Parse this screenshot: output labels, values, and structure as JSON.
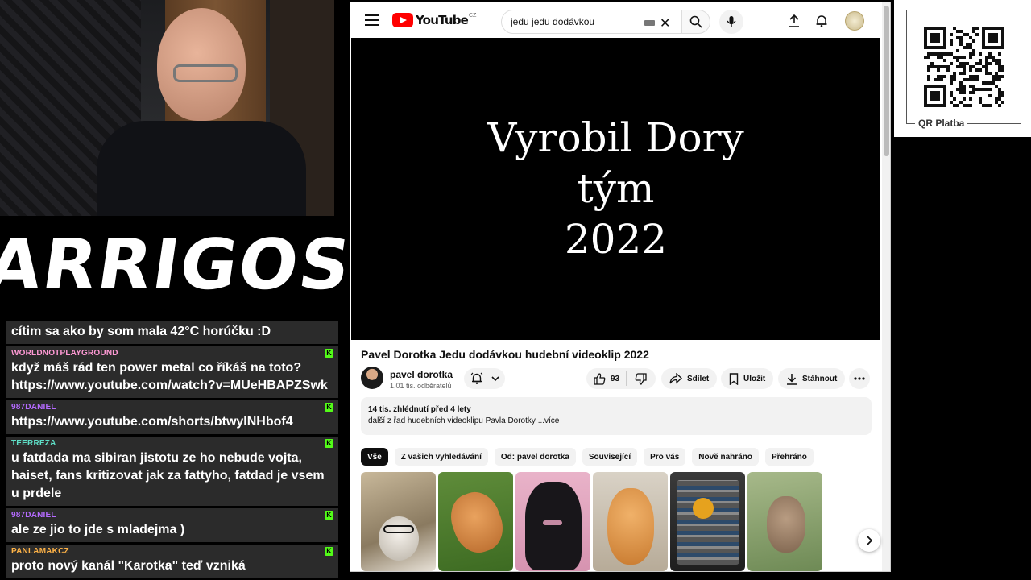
{
  "stream": {
    "logo_text": "ARRIGOS"
  },
  "chat": {
    "messages": [
      {
        "user": "",
        "text": "cítim sa ako by som mala 42°C horúčku :D",
        "color": "#ffffff",
        "badge": false
      },
      {
        "user": "WORLDNOTPLAYGROUND",
        "text": "když máš rád ten power metal co říkáš na toto? https://www.youtube.com/watch?v=MUeHBAPZSwk",
        "color": "#ff9ad5",
        "badge": true
      },
      {
        "user": "987DANIEL",
        "text": "https://www.youtube.com/shorts/btwyINHbof4",
        "color": "#b56bff",
        "badge": true
      },
      {
        "user": "TEERREZA",
        "text": "u fatdada ma sibiran jistotu ze ho nebude vojta, haiset, fans kritizovat jak za fattyho, fatdad je vsem u prdele",
        "color": "#5fe0c8",
        "badge": true
      },
      {
        "user": "987DANIEL",
        "text": "ale ze jio to jde s mladejma )",
        "color": "#b56bff",
        "badge": true
      },
      {
        "user": "PANLAMAKCZ",
        "text": "proto nový kanál \"Karotka\" teď vzniká",
        "color": "#ffb347",
        "badge": true
      }
    ]
  },
  "youtube": {
    "logo_word": "YouTube",
    "country_code": "CZ",
    "search_query": "jedu jedu dodávkou",
    "player_text": [
      "Vyrobil Dory",
      "tým",
      "2022"
    ],
    "video_title": "Pavel Dorotka Jedu dodávkou hudební videoklip 2022",
    "channel_name": "pavel dorotka",
    "subscribers": "1,01 tis. odběratelů",
    "like_count": "93",
    "share_label": "Sdílet",
    "save_label": "Uložit",
    "download_label": "Stáhnout",
    "views_date": "14 tis. zhlédnutí  před 4 lety",
    "description_snippet": "další z řad hudebních videoklipu Pavla Dorotky ",
    "more_label": "...více",
    "chips": [
      "Vše",
      "Z vašich vyhledávání",
      "Od: pavel dorotka",
      "Související",
      "Pro vás",
      "Nově nahráno",
      "Přehráno"
    ],
    "thumbnails": [
      "hamster-with-glasses",
      "fox-sleeping",
      "bat-hanging",
      "orange-cat",
      "radio-electronics",
      "baby-rabbit"
    ]
  },
  "qr": {
    "label": "QR Platba"
  },
  "colors": {
    "accent_red": "#ff0000",
    "kick_green": "#53fc18",
    "chat_bg": "#2b2b2b"
  }
}
